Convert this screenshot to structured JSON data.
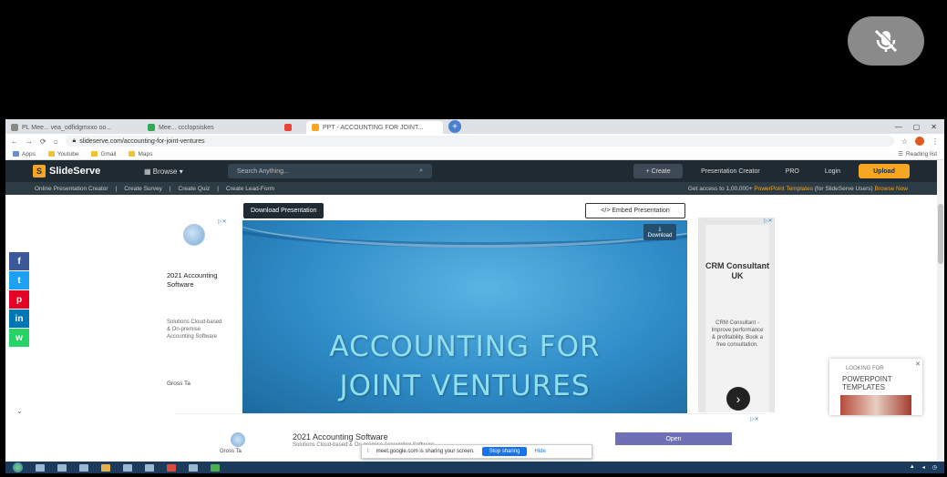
{
  "browser": {
    "tabs": [
      {
        "label": "PL Mee... vea_odfidgmxxo oo..."
      },
      {
        "label": "Mee... ccclopsiskes"
      },
      {
        "label": ""
      },
      {
        "label": "PPT - ACCOUNTING FOR JOINT..."
      }
    ],
    "new_tab": "+",
    "url": "slideserve.com/accounting-for-joint-ventures",
    "bookmarks": [
      "Apps",
      "Youtube",
      "Gmail",
      "Maps"
    ],
    "reading_list": "Reading list"
  },
  "site": {
    "logo_letter": "S",
    "logo_text": "SlideServe",
    "browse": "Browse",
    "search_placeholder": "Search Anything...",
    "create": "+ Create",
    "nav_presentation_creator": "Presentation Creator",
    "nav_pro": "PRO",
    "nav_login": "Login",
    "upload": "Upload",
    "subnav": [
      "Online Presentation Creator",
      "Create Survey",
      "Create Quiz",
      "Create Lead-Form"
    ],
    "promo_prefix": "Get access to 1,00,000+",
    "promo_highlight1": "PowerPoint Templates",
    "promo_mid": "(for SlideServe Users)",
    "promo_highlight2": "Browse Now"
  },
  "buttons": {
    "download_presentation": "Download Presentation",
    "embed_presentation": "Embed Presentation",
    "slide_download": "Download"
  },
  "slide": {
    "title_line1": "ACCOUNTING FOR",
    "title_line2": "JOINT VENTURES"
  },
  "left_ad": {
    "ad_marker": "▷✕",
    "title": "2021 Accounting Software",
    "desc": "Solutions Cloud-based & On-premise Accounting Software",
    "cta": "Gross Ta"
  },
  "right_ad": {
    "ad_marker": "▷✕",
    "title": "CRM Consultant UK",
    "desc": "CRM Consultant - Improve performance & profitability. Book a free consultation.",
    "arrow": "›"
  },
  "ppt_ad": {
    "line1": "LOOKING FOR",
    "line2": "POWERPOINT TEMPLATES",
    "close": "✕"
  },
  "social": [
    "f",
    "t",
    "p",
    "in",
    "w"
  ],
  "bottom_ad": {
    "brand": "Gross Ta",
    "title": "2021 Accounting Software",
    "desc": "Solutions Cloud-based & On-premise Accounting Software",
    "open": "Open",
    "ad_marker": "▷✕"
  },
  "share_bar": {
    "text": "meet.google.com is sharing your screen.",
    "stop": "Stop sharing",
    "hide": "Hide"
  },
  "colors": {
    "site_header": "#1f2a33",
    "accent": "#f5a623",
    "slide_text": "#8fe0ec",
    "taskbar": "#1c3b5c"
  }
}
